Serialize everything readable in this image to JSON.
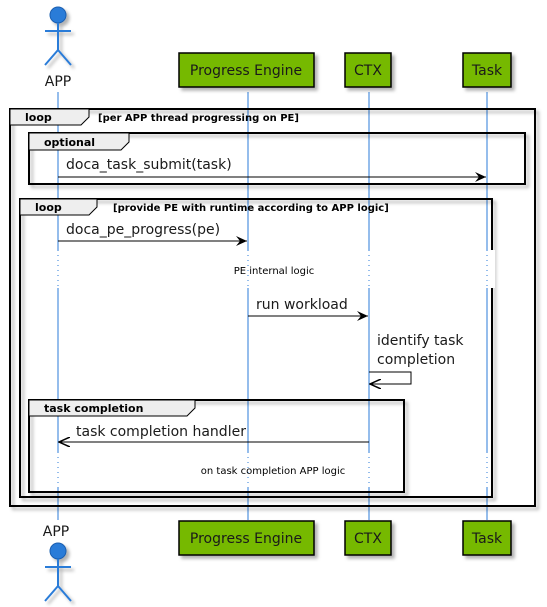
{
  "diagram": {
    "type": "sequence",
    "participants": [
      {
        "id": "app",
        "label": "APP",
        "kind": "actor",
        "color": "#2b7bd8"
      },
      {
        "id": "pe",
        "label": "Progress Engine",
        "kind": "participant",
        "color": "#76b900"
      },
      {
        "id": "ctx",
        "label": "CTX",
        "kind": "participant",
        "color": "#76b900"
      },
      {
        "id": "task",
        "label": "Task",
        "kind": "participant",
        "color": "#76b900"
      }
    ],
    "fragments": {
      "outer_loop": {
        "label": "loop",
        "guard": "[per APP thread progressing on PE]"
      },
      "optional": {
        "label": "optional",
        "guard": ""
      },
      "inner_loop": {
        "label": "loop",
        "guard": "[provide PE with runtime according to APP logic]"
      },
      "task_completion": {
        "label": "task completion",
        "guard": ""
      }
    },
    "messages": [
      {
        "from": "APP",
        "to": "Task",
        "label": "doca_task_submit(task)"
      },
      {
        "from": "APP",
        "to": "Progress Engine",
        "label": "doca_pe_progress(pe)"
      },
      {
        "from": "Progress Engine",
        "to": "CTX",
        "label": "run workload"
      },
      {
        "from": "CTX",
        "to": "CTX",
        "label_line1": "identify task",
        "label_line2": "completion"
      },
      {
        "from": "CTX",
        "to": "APP",
        "label": "task completion handler"
      }
    ],
    "delays": [
      {
        "label": "PE internal logic"
      },
      {
        "label": "on task completion APP logic"
      }
    ],
    "colors": {
      "lifeline": "#2b7bd8",
      "participant_fill": "#76b900",
      "fragment_header": "#eeeeee",
      "border": "#000000"
    }
  }
}
